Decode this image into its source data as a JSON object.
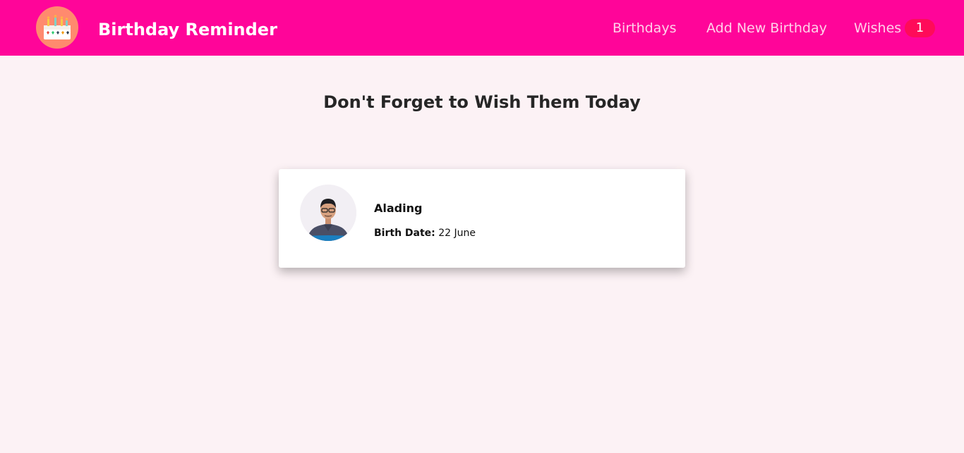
{
  "navbar": {
    "logo_icon": "birthday-cake-icon",
    "brand": "Birthday Reminder",
    "links": {
      "birthdays": "Birthdays",
      "add_new": "Add New Birthday",
      "wishes": "Wishes"
    },
    "wishes_count": "1"
  },
  "main": {
    "title": "Don't Forget to Wish Them Today",
    "cards": [
      {
        "name": "Alading",
        "birth_date_label": "Birth Date:",
        "birth_date": "22 June",
        "avatar_icon": "person-photo"
      }
    ]
  },
  "colors": {
    "navbar_bg": "#ff0599",
    "badge_bg": "#ff0b59",
    "page_bg": "#fcf2f5",
    "logo_bg": "#ff8a6e"
  }
}
